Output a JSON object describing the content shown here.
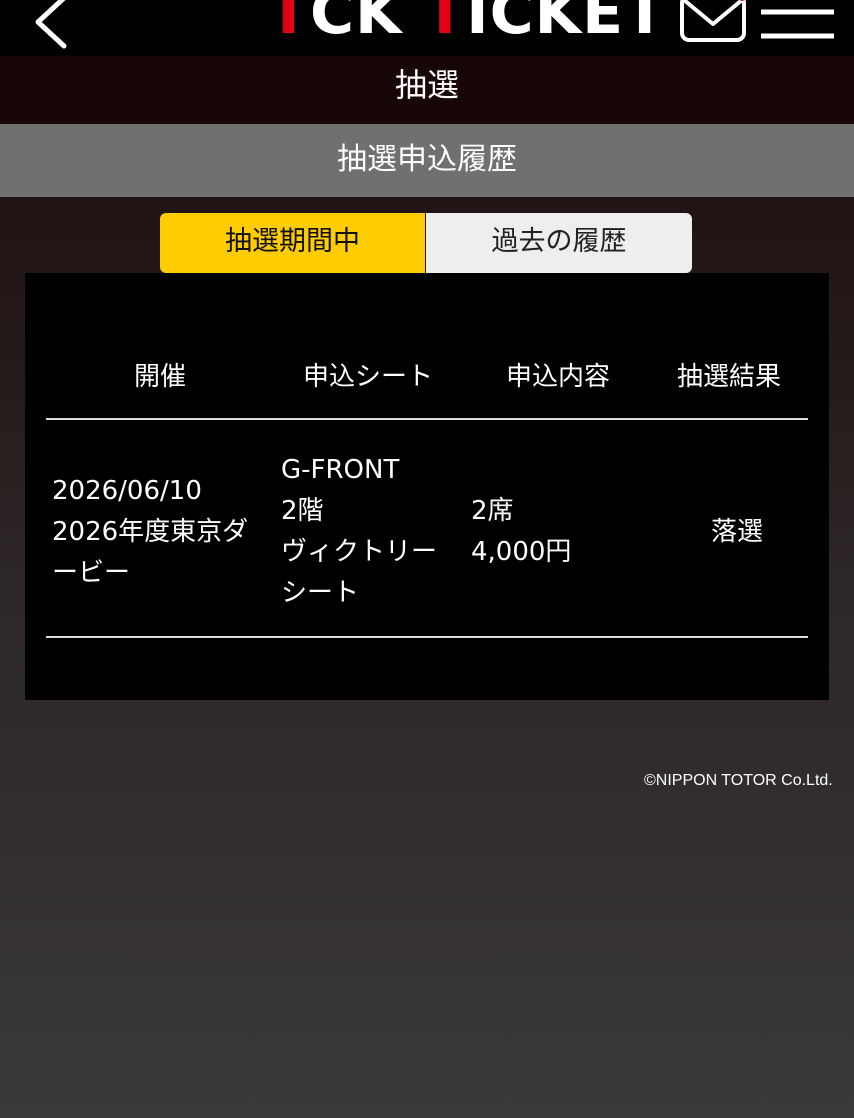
{
  "header": {
    "logo_part1": "T",
    "logo_part2": "CK ",
    "logo_part3": "T",
    "logo_part4": "ICKET",
    "brand_red": "#e30012",
    "icons": [
      "back-arrow-icon",
      "mail-icon",
      "hamburger-menu-icon"
    ]
  },
  "page": {
    "title": "抽選",
    "section_title": "抽選申込履歴"
  },
  "tabs": [
    {
      "label": "抽選期間中",
      "active": true,
      "color": "#ffcc00"
    },
    {
      "label": "過去の履歴",
      "active": false,
      "color": "#eeeeee"
    }
  ],
  "table": {
    "headers": [
      "開催",
      "申込シート",
      "申込内容",
      "抽選結果"
    ],
    "rows": [
      {
        "event_lines": [
          "2026/06/10",
          "2026年度東京ダ",
          "ービー"
        ],
        "seat_lines": [
          "G-FRONT",
          "2階",
          "ヴィクトリー",
          "シート"
        ],
        "content_lines": [
          "2席",
          "4,000円"
        ],
        "result": "落選"
      }
    ]
  },
  "footer": {
    "copyright": "©NIPPON TOTOR Co.Ltd."
  }
}
